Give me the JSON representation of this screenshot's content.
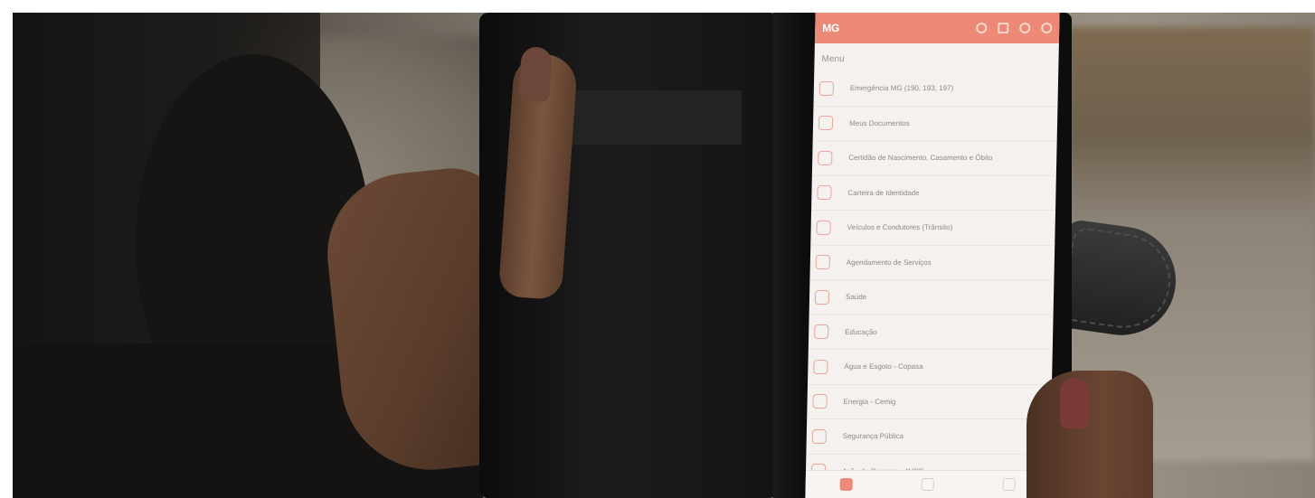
{
  "app": {
    "brand": "MG",
    "menu_title": "Menu"
  },
  "menu": {
    "items": [
      {
        "label": "Emergência MG (190, 193, 197)",
        "icon": "alert-triangle-icon"
      },
      {
        "label": "Meus Documentos",
        "icon": "folder-icon"
      },
      {
        "label": "Certidão de Nascimento, Casamento e Óbito",
        "icon": "certificate-icon"
      },
      {
        "label": "Carteira de Identidade",
        "icon": "id-card-icon"
      },
      {
        "label": "Veículos e Condutores (Trânsito)",
        "icon": "car-icon"
      },
      {
        "label": "Agendamento de Serviços",
        "icon": "calendar-icon"
      },
      {
        "label": "Saúde",
        "icon": "health-icon"
      },
      {
        "label": "Educação",
        "icon": "graduation-cap-icon"
      },
      {
        "label": "Água e Esgoto - Copasa",
        "icon": "water-drop-icon"
      },
      {
        "label": "Energia - Cemig",
        "icon": "lightbulb-icon"
      },
      {
        "label": "Segurança Pública",
        "icon": "police-icon"
      },
      {
        "label": "Ação de Governo - AVCB",
        "icon": "people-search-icon"
      }
    ]
  },
  "colors": {
    "accent": "#ec8a77",
    "screen_bg": "#f4f1ee",
    "label_text": "#8f8984"
  }
}
